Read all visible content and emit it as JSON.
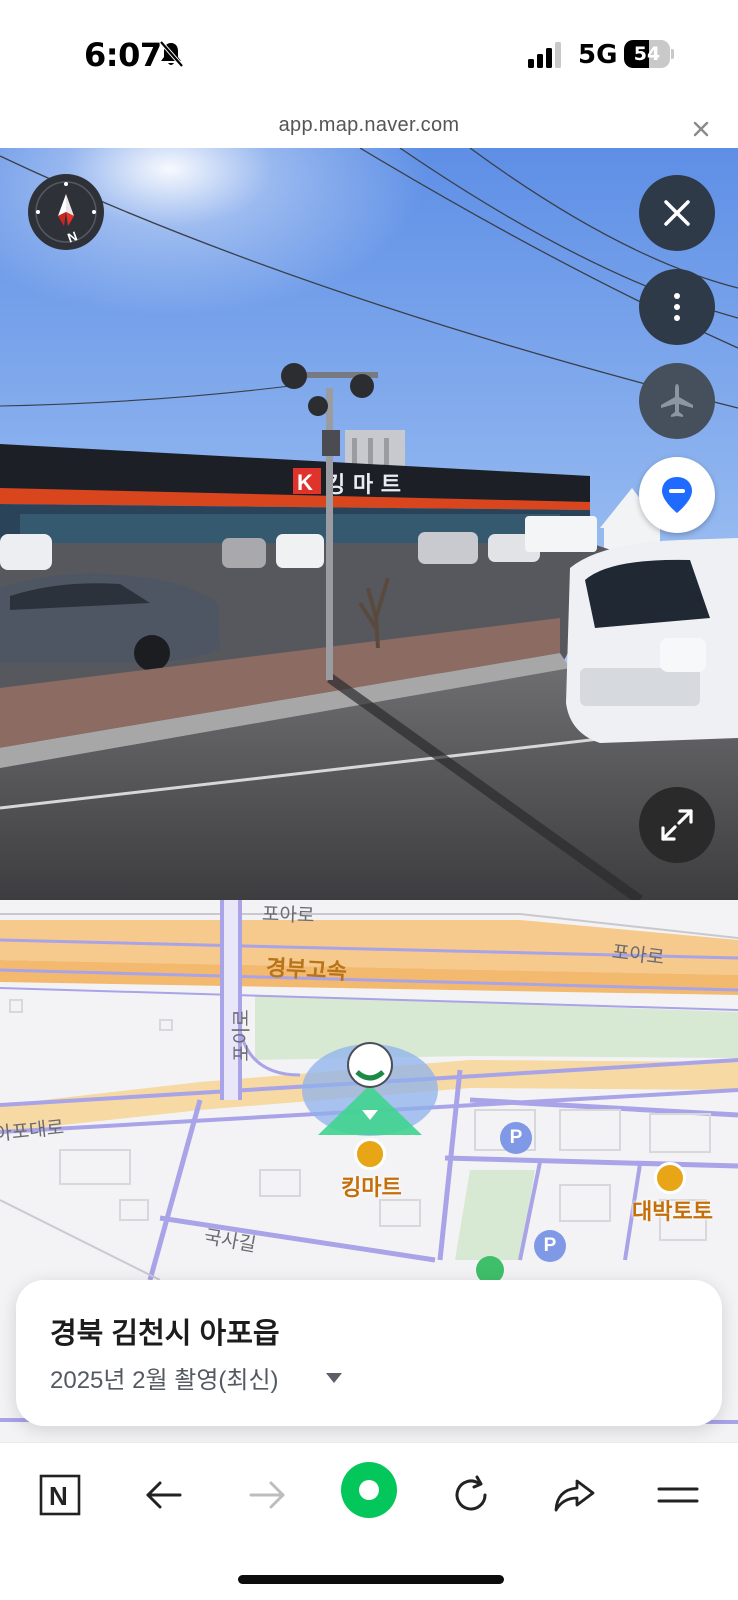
{
  "status_bar": {
    "time": "6:07",
    "network": "5G",
    "battery_percent": "54",
    "battery_level": 0.54
  },
  "browser": {
    "url": "app.map.naver.com",
    "close_icon": "close-icon"
  },
  "panorama": {
    "store_sign_letter": "K",
    "store_sign_text": "킹 마 트",
    "controls": {
      "compass_label": "N",
      "close_icon": "close-icon",
      "more_icon": "more-vertical-icon",
      "airplane_icon": "airplane-icon",
      "location_icon": "location-pin-icon",
      "expand_icon": "expand-icon"
    }
  },
  "map": {
    "road_labels": {
      "poa_ro_top": "포아로",
      "poa_ro_right": "포아로",
      "gyeongbu_expressway": "경부고속",
      "poi_ro_vertical": "포이로",
      "apo_daero": "아포대로",
      "guksa_gil": "국사길"
    },
    "pois": {
      "king_mart": "킹마트",
      "daebak_toto": "대박토토"
    },
    "parking_label": "P"
  },
  "location_card": {
    "title": "경북 김천시 아포읍",
    "subtitle": "2025년 2월 촬영(최신)"
  },
  "toolbar": {
    "naver_label": "N"
  },
  "colors": {
    "road_orange": "#f6c98c",
    "road_purple": "#a9a3e8",
    "park_green": "#d4e8cf",
    "naver_green": "#03c75a",
    "location_blue": "#1f6bff"
  }
}
